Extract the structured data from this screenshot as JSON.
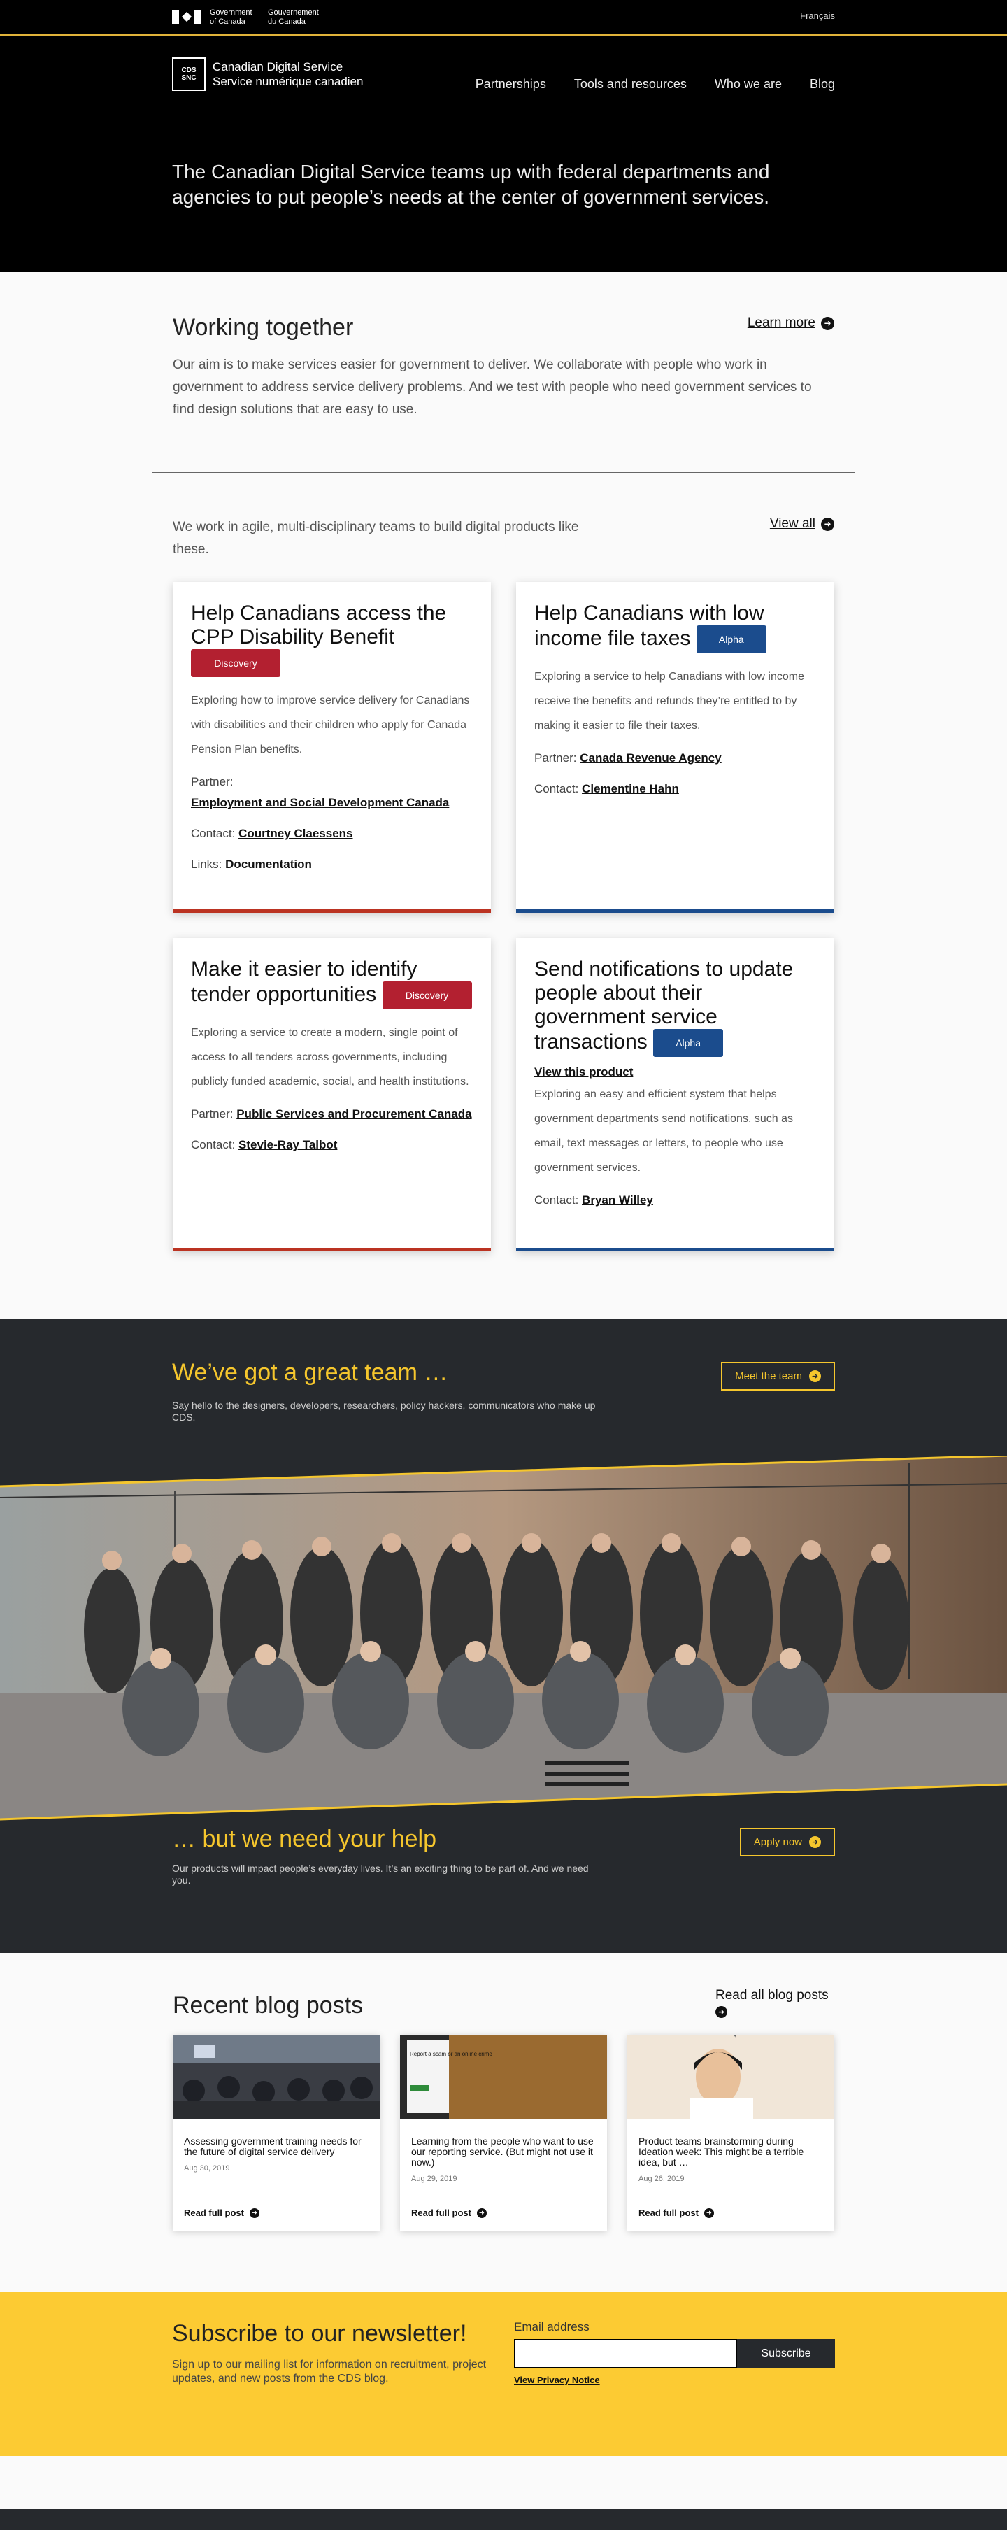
{
  "fip": {
    "gov_en_1": "Government",
    "gov_en_2": "of Canada",
    "gov_fr_1": "Gouvernement",
    "gov_fr_2": "du Canada",
    "lang": "Français"
  },
  "header": {
    "logo_box_1": "CDS",
    "logo_box_2": "SNC",
    "name_en": "Canadian Digital Service",
    "name_fr": "Service numérique canadien",
    "nav": [
      "Partnerships",
      "Tools and resources",
      "Who we are",
      "Blog"
    ],
    "lead": "The Canadian Digital Service teams up with federal departments and agencies to put people’s needs at the center of government services."
  },
  "working": {
    "title": "Working together",
    "learn_more": "Learn more",
    "body": "Our aim is to make services easier for government to deliver. We collaborate with people who work in government to address service delivery problems. And we test with people who need government services to find design solutions that are easy to use."
  },
  "products": {
    "intro": "We work in agile, multi-disciplinary teams to build digital products like these.",
    "view_all": "View all",
    "cards": [
      {
        "title": "Help Canadians access the CPP Disability Benefit",
        "badge": "Discovery",
        "body": "Exploring how to improve service delivery for Canadians with disabilities and their children who apply for Canada Pension Plan benefits.",
        "partner_label": "Partner:",
        "partner": "Employment and Social Development Canada",
        "contact_label": "Contact:",
        "contact": "Courtney Claessens",
        "links_label": "Links:",
        "links": "Documentation"
      },
      {
        "title": "Help Canadians with low income file taxes",
        "badge": "Alpha",
        "body": "Exploring a service to help Canadians with low income receive the benefits and refunds they’re entitled to by making it easier to file their taxes.",
        "partner_label": "Partner:",
        "partner": "Canada Revenue Agency",
        "contact_label": "Contact:",
        "contact": "Clementine Hahn"
      },
      {
        "title": "Make it easier to identify tender opportunities",
        "badge": "Discovery",
        "body": "Exploring a service to create a modern, single point of access to all tenders across governments, including publicly funded academic, social, and health institutions.",
        "partner_label": "Partner:",
        "partner": "Public Services and Procurement Canada",
        "contact_label": "Contact:",
        "contact": "Stevie-Ray Talbot"
      },
      {
        "title": "Send notifications to update people about their government service transactions",
        "badge": "Alpha",
        "view_product": "View this product",
        "body": "Exploring an easy and efficient system that helps government departments send notifications, such as email, text messages or letters, to people who use government services.",
        "contact_label": "Contact:",
        "contact": "Bryan Willey"
      }
    ]
  },
  "team": {
    "title": "We’ve got a great team …",
    "sub": "Say hello to the designers, developers, researchers, policy hackers, communicators who make up CDS.",
    "meet": "Meet the team",
    "help_title": "… but we need your help",
    "help_sub": "Our products will impact people’s everyday lives. It’s an exciting thing to be part of. And we need you.",
    "apply": "Apply now"
  },
  "blog": {
    "title": "Recent blog posts",
    "read_all": "Read all blog posts",
    "read_full": "Read full post",
    "posts": [
      {
        "title": "Assessing government training needs for the future of digital service delivery",
        "date": "Aug 30, 2019"
      },
      {
        "title": "Learning from the people who want to use our reporting service. (But might not use it now.)",
        "date": "Aug 29, 2019"
      },
      {
        "title": "Product teams brainstorming during Ideation week: This might be a terrible idea, but …",
        "date": "Aug 26, 2019"
      }
    ],
    "phone_text": "Report a scam or an online crime"
  },
  "subscribe": {
    "title": "Subscribe to our newsletter!",
    "body": "Sign up to our mailing list for information on recruitment, project updates, and new posts from the CDS blog.",
    "email_label": "Email address",
    "button": "Subscribe",
    "privacy": "View Privacy Notice"
  },
  "colors": {
    "accent_yellow": "#fccb33",
    "discovery_red": "#b32030",
    "alpha_blue": "#1b4c8d",
    "dark": "#26292d"
  }
}
